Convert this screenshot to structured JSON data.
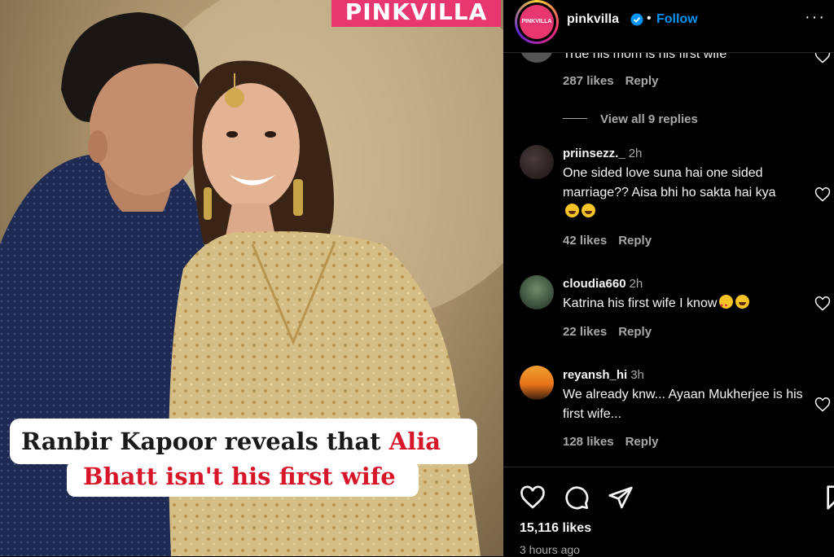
{
  "post": {
    "brand": "PINKVILLA",
    "headline_black": "Ranbir Kapoor reveals that ",
    "headline_red_1": "Alia",
    "headline_red_2": "Bhatt isn't his first wife"
  },
  "header": {
    "avatar_text": "PINKVILLA",
    "username": "pinkvilla",
    "separator": "•",
    "follow_label": "Follow",
    "more_label": "···"
  },
  "comments": {
    "partial": {
      "text": "True his mom is his first wife",
      "likes": "287 likes",
      "reply": "Reply",
      "view_replies": "View all 9 replies"
    },
    "items": [
      {
        "username": "priinsezz._",
        "time": "2h",
        "text": "One sided love suna hai one sided marriage?? Aisa bhi ho sakta hai kya",
        "emojis": [
          "laugh",
          "laugh"
        ],
        "likes": "42 likes",
        "reply": "Reply"
      },
      {
        "username": "cloudia660",
        "time": "2h",
        "text": "Katrina his first wife I know",
        "emojis": [
          "love",
          "laugh"
        ],
        "likes": "22 likes",
        "reply": "Reply"
      },
      {
        "username": "reyansh_hi",
        "time": "3h",
        "text": "We already knw... Ayaan Mukherjee is his first wife...",
        "emojis": [],
        "likes": "128 likes",
        "reply": "Reply"
      }
    ]
  },
  "actions": {
    "likes": "15,116 likes",
    "time_ago": "3 hours ago"
  },
  "colors": {
    "brand_pink": "#e8366f",
    "follow_blue": "#0095f6",
    "headline_red": "#d8162a"
  }
}
